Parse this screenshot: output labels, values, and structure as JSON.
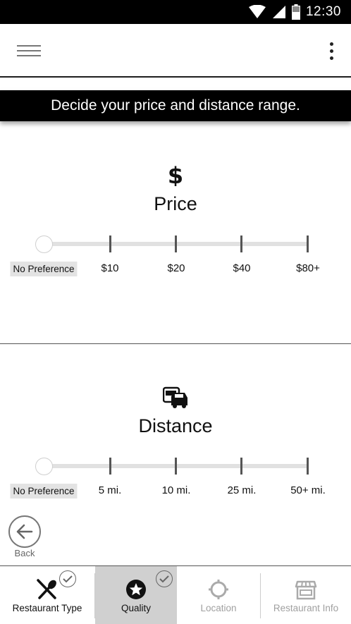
{
  "status_bar": {
    "time": "12:30"
  },
  "banner": {
    "text": "Decide your price and distance range."
  },
  "price": {
    "title": "Price",
    "icon": "dollar-icon",
    "selected_label": "No Preference",
    "options": [
      "No Preference",
      "$10",
      "$20",
      "$40",
      "$80+"
    ],
    "selected_index": 0
  },
  "distance": {
    "title": "Distance",
    "icon": "car-icon",
    "selected_label": "No Preference",
    "options": [
      "No Preference",
      "5 mi.",
      "10 mi.",
      "25 mi.",
      "50+ mi."
    ],
    "selected_index": 0
  },
  "back": {
    "label": "Back"
  },
  "bottom_nav": {
    "tabs": [
      {
        "label": "Restaurant Type",
        "icon": "utensils-icon",
        "completed": true,
        "active": false,
        "enabled": true
      },
      {
        "label": "Quality",
        "icon": "star-badge-icon",
        "completed": true,
        "active": true,
        "enabled": true
      },
      {
        "label": "Location",
        "icon": "crosshair-icon",
        "completed": false,
        "active": false,
        "enabled": false
      },
      {
        "label": "Restaurant Info",
        "icon": "storefront-icon",
        "completed": false,
        "active": false,
        "enabled": false
      }
    ]
  },
  "colors": {
    "status_bar_bg": "#000000",
    "banner_bg": "#000000",
    "track": "#e1e1e1",
    "active_tab_bg": "#d0d0d0",
    "disabled_text": "#a0a0a0"
  }
}
